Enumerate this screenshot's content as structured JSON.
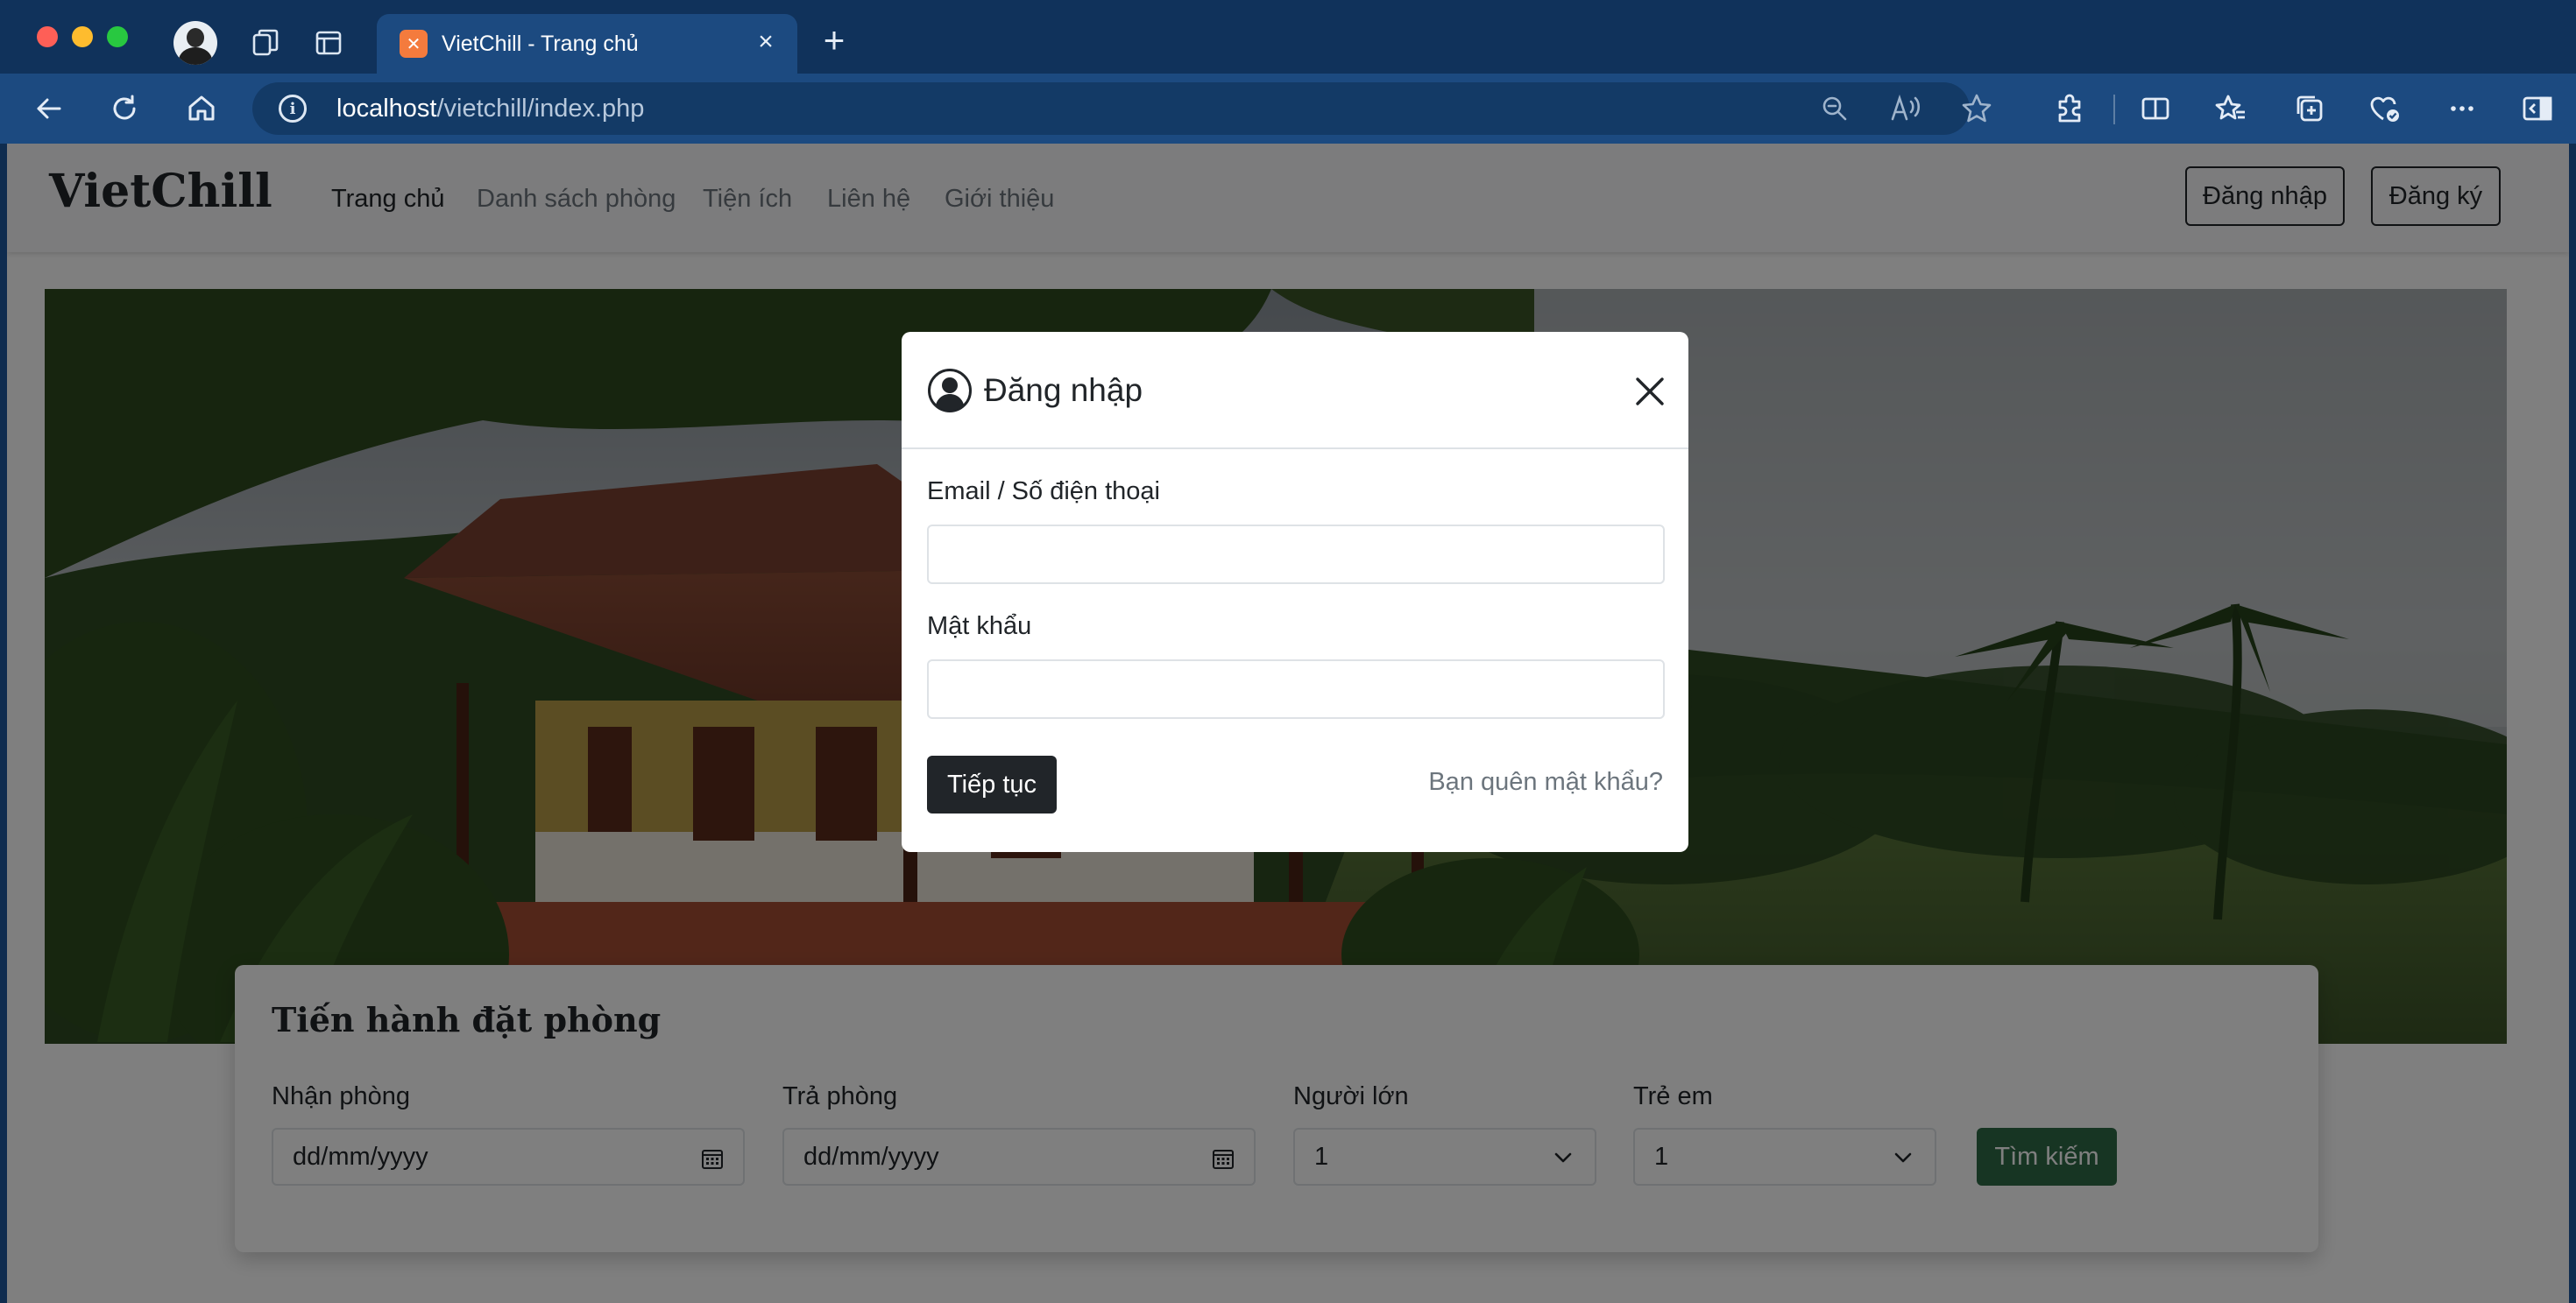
{
  "browser": {
    "tab_title": "VietChill - Trang chủ",
    "url_host": "localhost",
    "url_path": "/vietchill/index.php"
  },
  "site": {
    "brand": "VietChill",
    "nav": [
      "Trang chủ",
      "Danh sách phòng",
      "Tiện ích",
      "Liên hệ",
      "Giới thiệu"
    ],
    "login_label": "Đăng nhập",
    "register_label": "Đăng ký"
  },
  "booking": {
    "title": "Tiến hành đặt phòng",
    "checkin_label": "Nhận phòng",
    "checkin_placeholder": "dd/mm/yyyy",
    "checkout_label": "Trả phòng",
    "checkout_placeholder": "dd/mm/yyyy",
    "adults_label": "Người lớn",
    "adults_value": "1",
    "children_label": "Trẻ em",
    "children_value": "1",
    "search_label": "Tìm kiếm"
  },
  "modal": {
    "title": "Đăng nhập",
    "email_label": "Email / Số điện thoại",
    "email_value": "",
    "password_label": "Mật khẩu",
    "password_value": "",
    "submit_label": "Tiếp tục",
    "forgot_label": "Bạn quên mật khẩu?"
  },
  "colors": {
    "chrome_dark": "#10325b",
    "chrome_toolbar": "#1c4a80",
    "primary_dark": "#212529",
    "search_green": "#2e6b46"
  }
}
